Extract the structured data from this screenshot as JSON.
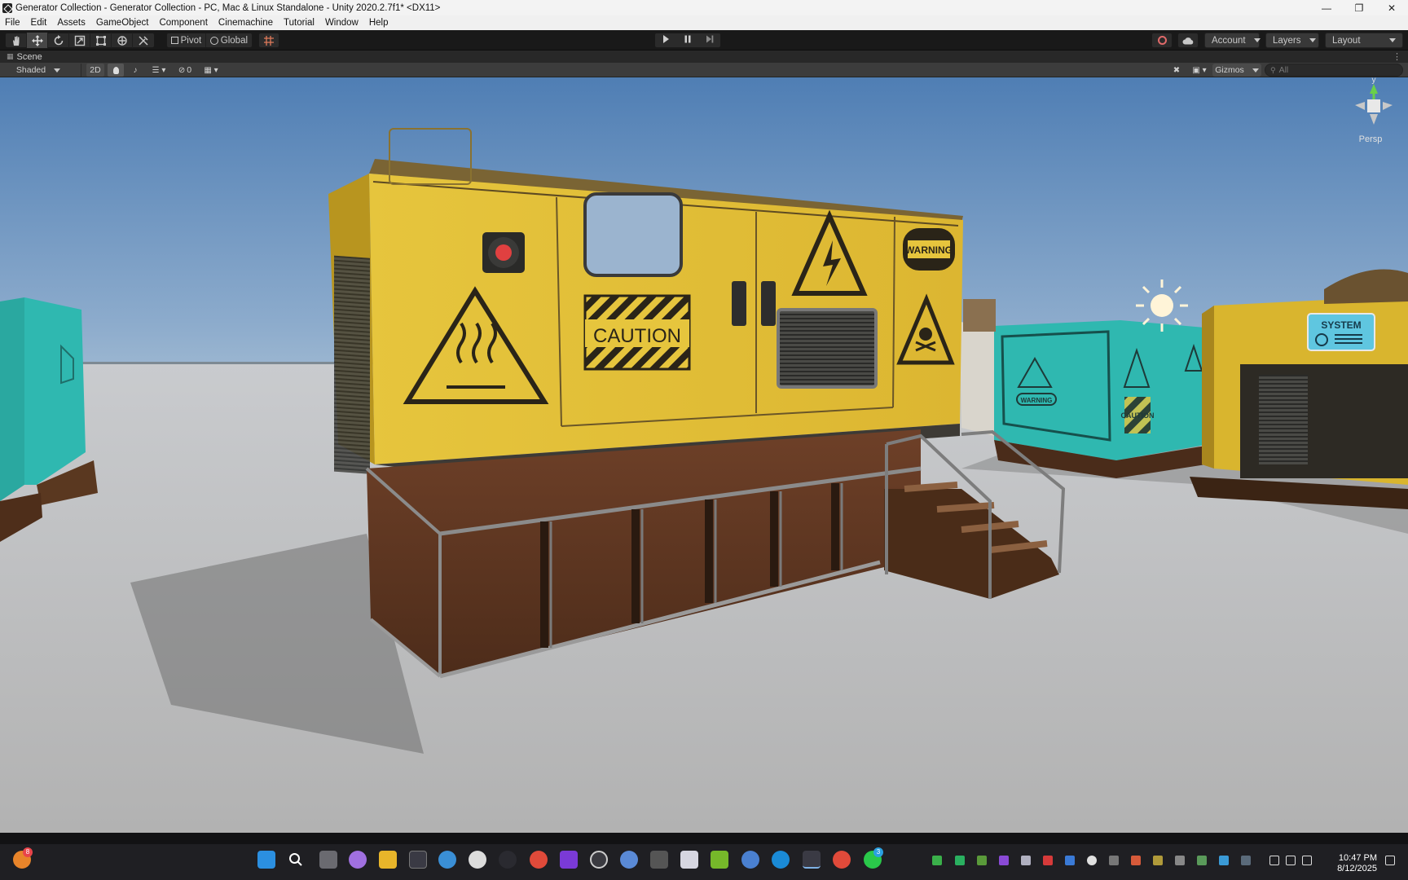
{
  "window": {
    "title": "Generator Collection - Generator Collection - PC, Mac & Linux Standalone - Unity 2020.2.7f1* <DX11>",
    "controls": [
      "minimize",
      "maximize",
      "close"
    ]
  },
  "menu": [
    "File",
    "Edit",
    "Assets",
    "GameObject",
    "Component",
    "Cinemachine",
    "Tutorial",
    "Window",
    "Help"
  ],
  "toolbar": {
    "tools": [
      "hand-tool",
      "move-tool",
      "rotate-tool",
      "scale-tool",
      "rect-tool",
      "transform-tool",
      "custom-tool"
    ],
    "active_tool": "move-tool",
    "pivot_label": "Pivot",
    "global_label": "Global",
    "play_controls": [
      "play",
      "pause",
      "step"
    ],
    "account_label": "Account",
    "layers_label": "Layers",
    "layout_label": "Layout"
  },
  "scene_tab": {
    "label": "Scene"
  },
  "scene_toolbar": {
    "shading_mode": "Shaded",
    "mode_2d": "2D",
    "hidden_count": "0",
    "gizmos_label": "Gizmos",
    "search_placeholder": "All"
  },
  "viewport": {
    "projection_label": "Persp",
    "gizmo_axis_label": "y",
    "decals": {
      "caution": "CAUTION",
      "warning": "WARNING",
      "system": "SYSTEM",
      "small_warning": "WARNING",
      "small_caution": "CAUTION"
    },
    "colors": {
      "sky_top": "#4f7eb4",
      "sky_horizon": "#a7bfd4",
      "ground": "#bdbdbd",
      "generator_body": "#e8c53a",
      "base_rust": "#5e3620",
      "teal_unit": "#2fb8b0"
    }
  },
  "taskbar": {
    "notification_badge": "8",
    "whatsapp_badge": "3",
    "time": "10:47 PM",
    "date": "8/12/2025"
  }
}
